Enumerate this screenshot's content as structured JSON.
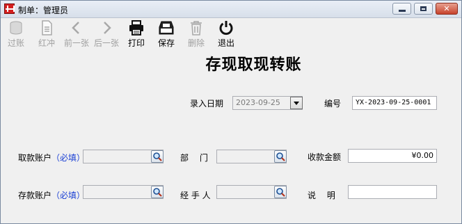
{
  "window": {
    "title": "制单：管理员"
  },
  "toolbar": {
    "post_label": "过账",
    "reverse_label": "红冲",
    "prev_label": "前一张",
    "next_label": "后一张",
    "print_label": "打印",
    "save_label": "保存",
    "delete_label": "删除",
    "exit_label": "退出"
  },
  "form": {
    "heading": "存现取现转账",
    "entry_date_label": "录入日期",
    "entry_date_value": "2023-09-25",
    "number_label": "编号",
    "number_value": "YX-2023-09-25-0001",
    "withdraw_account_label": "取款账户",
    "withdraw_account_required": "（必填）",
    "withdraw_account_value": "",
    "department_label": "部　 门",
    "department_value": "",
    "amount_label": "收款金额",
    "amount_value": "¥0.00",
    "deposit_account_label": "存款账户",
    "deposit_account_required": "（必填）",
    "deposit_account_value": "",
    "handler_label": "经 手 人",
    "handler_value": "",
    "note_label": "说　 明",
    "note_value": ""
  },
  "icons": {
    "app": "app-red-grid-icon",
    "post": "coins-stack-icon",
    "reverse": "document-icon",
    "prev": "chevron-left-icon",
    "next": "chevron-right-icon",
    "print": "printer-icon",
    "save": "tray-save-icon",
    "delete": "trash-icon",
    "exit": "power-icon",
    "lookup": "magnifier-icon"
  },
  "colors": {
    "required_text": "#1a3fd4",
    "disabled_text": "#a0a0a0",
    "close_button": "#c7432c"
  }
}
